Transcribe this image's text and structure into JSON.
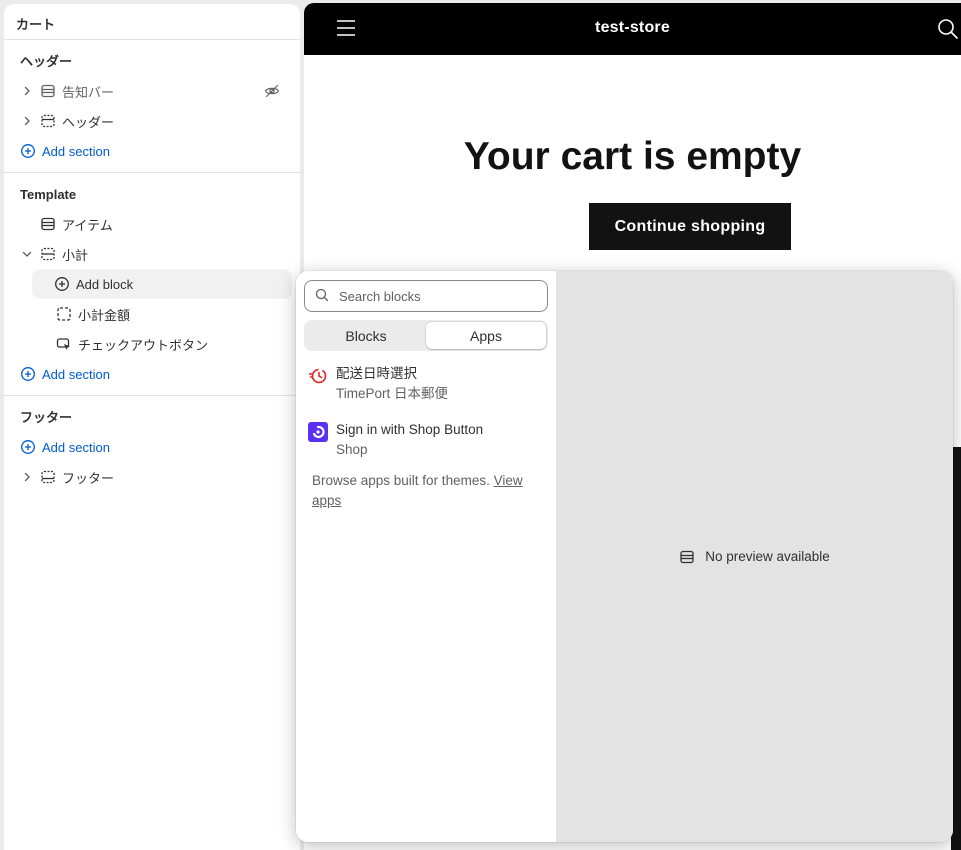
{
  "sidebar": {
    "title": "カート",
    "header_group": {
      "heading": "ヘッダー",
      "items": [
        {
          "label": "告知バー",
          "hidden": true
        },
        {
          "label": "ヘッダー"
        }
      ],
      "add_section": "Add section"
    },
    "template_group": {
      "heading": "Template",
      "items": [
        {
          "label": "アイテム"
        },
        {
          "label": "小計"
        }
      ],
      "add_block": "Add block",
      "blocks": [
        {
          "label": "小計金額"
        },
        {
          "label": "チェックアウトボタン"
        }
      ],
      "add_section": "Add section"
    },
    "footer_group": {
      "heading": "フッター",
      "add_section": "Add section",
      "items": [
        {
          "label": "フッター"
        }
      ]
    }
  },
  "preview": {
    "store_name": "test-store",
    "empty_title": "Your cart is empty",
    "continue_button": "Continue shopping"
  },
  "popover": {
    "search_placeholder": "Search blocks",
    "tabs": [
      {
        "label": "Blocks",
        "active": false
      },
      {
        "label": "Apps",
        "active": true
      }
    ],
    "apps": [
      {
        "name": "配送日時選択",
        "vendor": "TimePort 日本郵便",
        "icon": "clock-history-icon",
        "icon_color": "#e22120"
      },
      {
        "name": "Sign in with Shop Button",
        "vendor": "Shop",
        "icon": "shop-logo-icon",
        "icon_color": "#5a31f4"
      }
    ],
    "browse_text": "Browse apps built for themes.",
    "browse_link": "View apps",
    "no_preview": "No preview available"
  },
  "colors": {
    "accent": "#005bd3",
    "store_header_bg": "#000000",
    "button_bg": "#121212"
  }
}
